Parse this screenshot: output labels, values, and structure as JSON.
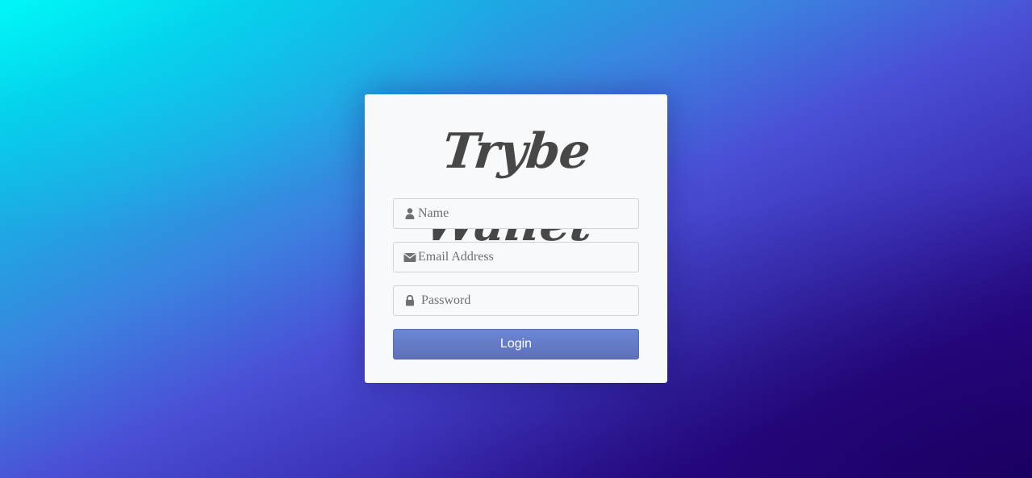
{
  "app": {
    "logo_text": "Trybe Wallet"
  },
  "form": {
    "name": {
      "icon": "user-icon",
      "placeholder": "Name",
      "value": ""
    },
    "email": {
      "icon": "envelope-icon",
      "placeholder": "Email Address",
      "value": ""
    },
    "password": {
      "icon": "lock-icon",
      "placeholder": "Password",
      "value": ""
    },
    "login_label": "Login"
  },
  "colors": {
    "card_background": "#f8f9fa",
    "logo_text": "#474747",
    "button_top": "#6a88d6",
    "button_bottom": "#5f6fb8",
    "icon": "#6c6f73"
  }
}
